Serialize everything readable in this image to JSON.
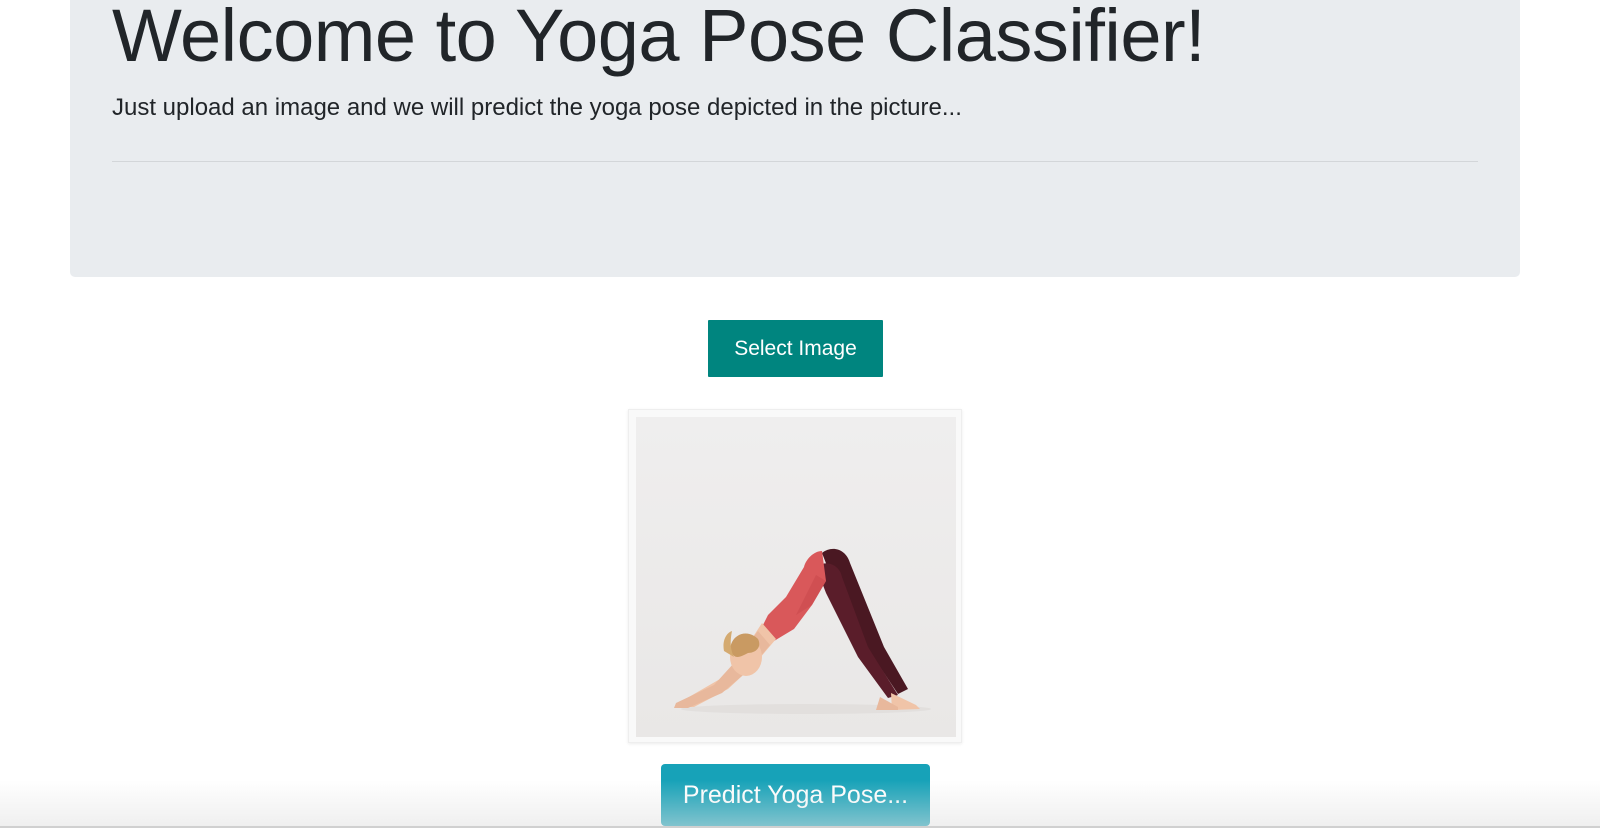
{
  "header": {
    "title": "Welcome to Yoga Pose Classifier!",
    "lead": "Just upload an image and we will predict the yoga pose depicted in the picture..."
  },
  "upload": {
    "select_label": "Select Image"
  },
  "preview": {
    "image_icon": "yoga-pose-photo"
  },
  "actions": {
    "predict_label": "Predict Yoga Pose..."
  },
  "colors": {
    "jumbotron_bg": "#e9ecef",
    "select_button": "#00857f",
    "predict_button": "#17a2b8"
  }
}
